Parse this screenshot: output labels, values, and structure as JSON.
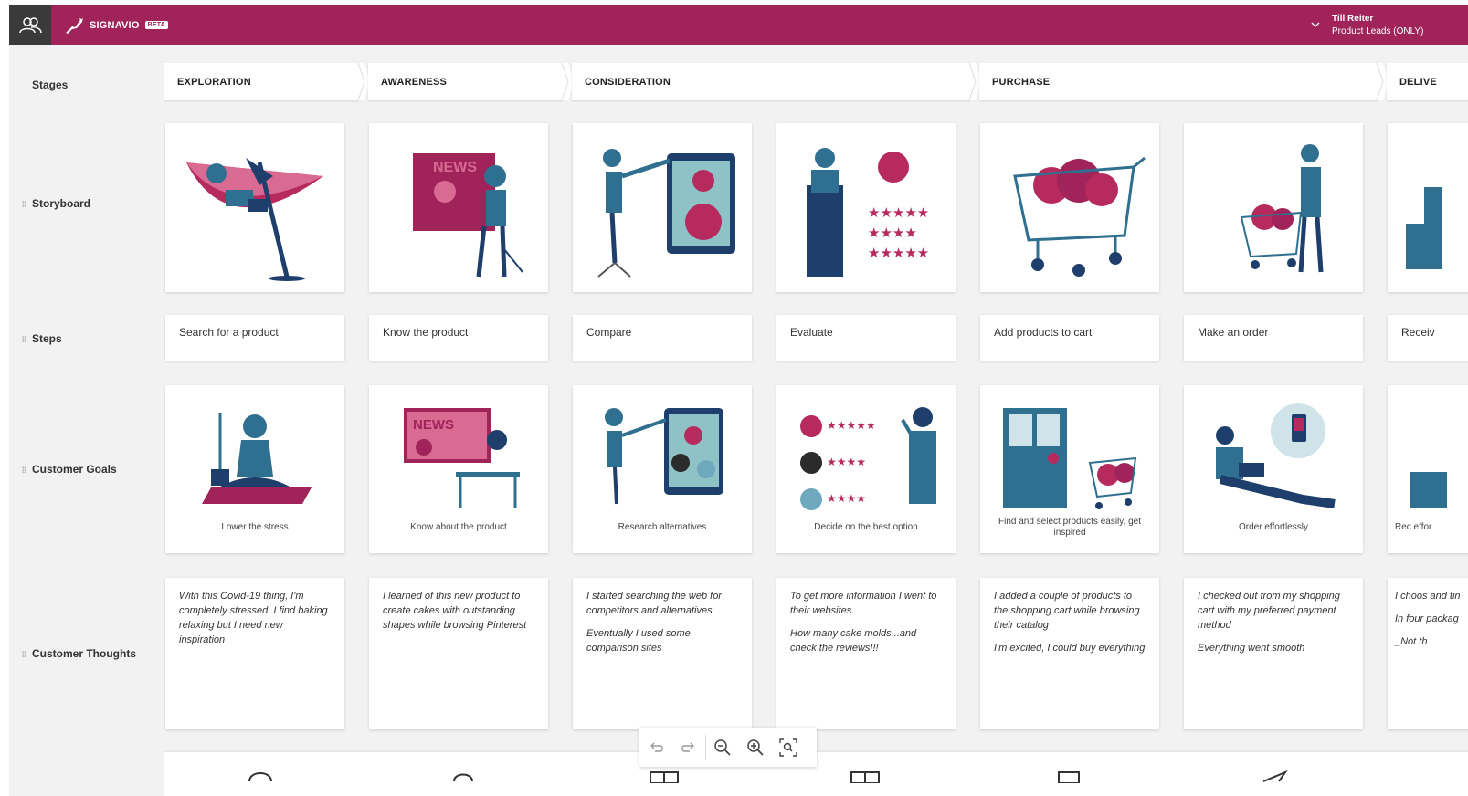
{
  "header": {
    "brand": "SIGNAVIO",
    "badge": "BETA",
    "user_name": "Till Reiter",
    "user_role": "Product Leads (ONLY)",
    "color": "#a0245a"
  },
  "rows": {
    "stages": "Stages",
    "storyboard": "Storyboard",
    "steps": "Steps",
    "goals": "Customer Goals",
    "thoughts": "Customer Thoughts"
  },
  "stages": [
    "EXPLORATION",
    "AWARENESS",
    "CONSIDERATION",
    "PURCHASE",
    "DELIVE"
  ],
  "steps": [
    "Search for a product",
    "Know the product",
    "Compare",
    "Evaluate",
    "Add products to cart",
    "Make an order",
    "Receiv"
  ],
  "goals": [
    "Lower the stress",
    "Know about the product",
    "Research alternatives",
    "Decide on the best option",
    "Find and select products easily, get inspired",
    "Order effortlessly",
    "Rec effor"
  ],
  "thoughts": [
    [
      "With this Covid-19 thing, I'm completely stressed. I find baking relaxing but I need new inspiration"
    ],
    [
      "I learned of this new product to create cakes with outstanding shapes while browsing Pinterest"
    ],
    [
      "I started searching the web for competitors and alternatives",
      "Eventually I used some comparison sites"
    ],
    [
      "To get more information I went to their websites.",
      "How many cake molds...and check the reviews!!!"
    ],
    [
      "I added a couple of products to the shopping cart while browsing their catalog",
      "I'm excited, I could buy everything"
    ],
    [
      "I checked out from my shopping cart with my preferred payment method",
      "Everything went smooth"
    ],
    [
      "I choos and tin",
      "In four packag",
      "_Not th"
    ]
  ],
  "icons": {
    "app_switcher": "users-icon",
    "brand": "deer-logo-icon",
    "undo": "undo-icon",
    "redo": "redo-icon",
    "zoom_out": "zoom-out-icon",
    "zoom_in": "zoom-in-icon",
    "zoom_fit": "zoom-fit-icon"
  },
  "colors": {
    "accent": "#a0245a",
    "illustration_teal": "#2f6f8f",
    "illustration_navy": "#1e3f6b",
    "illustration_pink": "#b62a5e"
  }
}
